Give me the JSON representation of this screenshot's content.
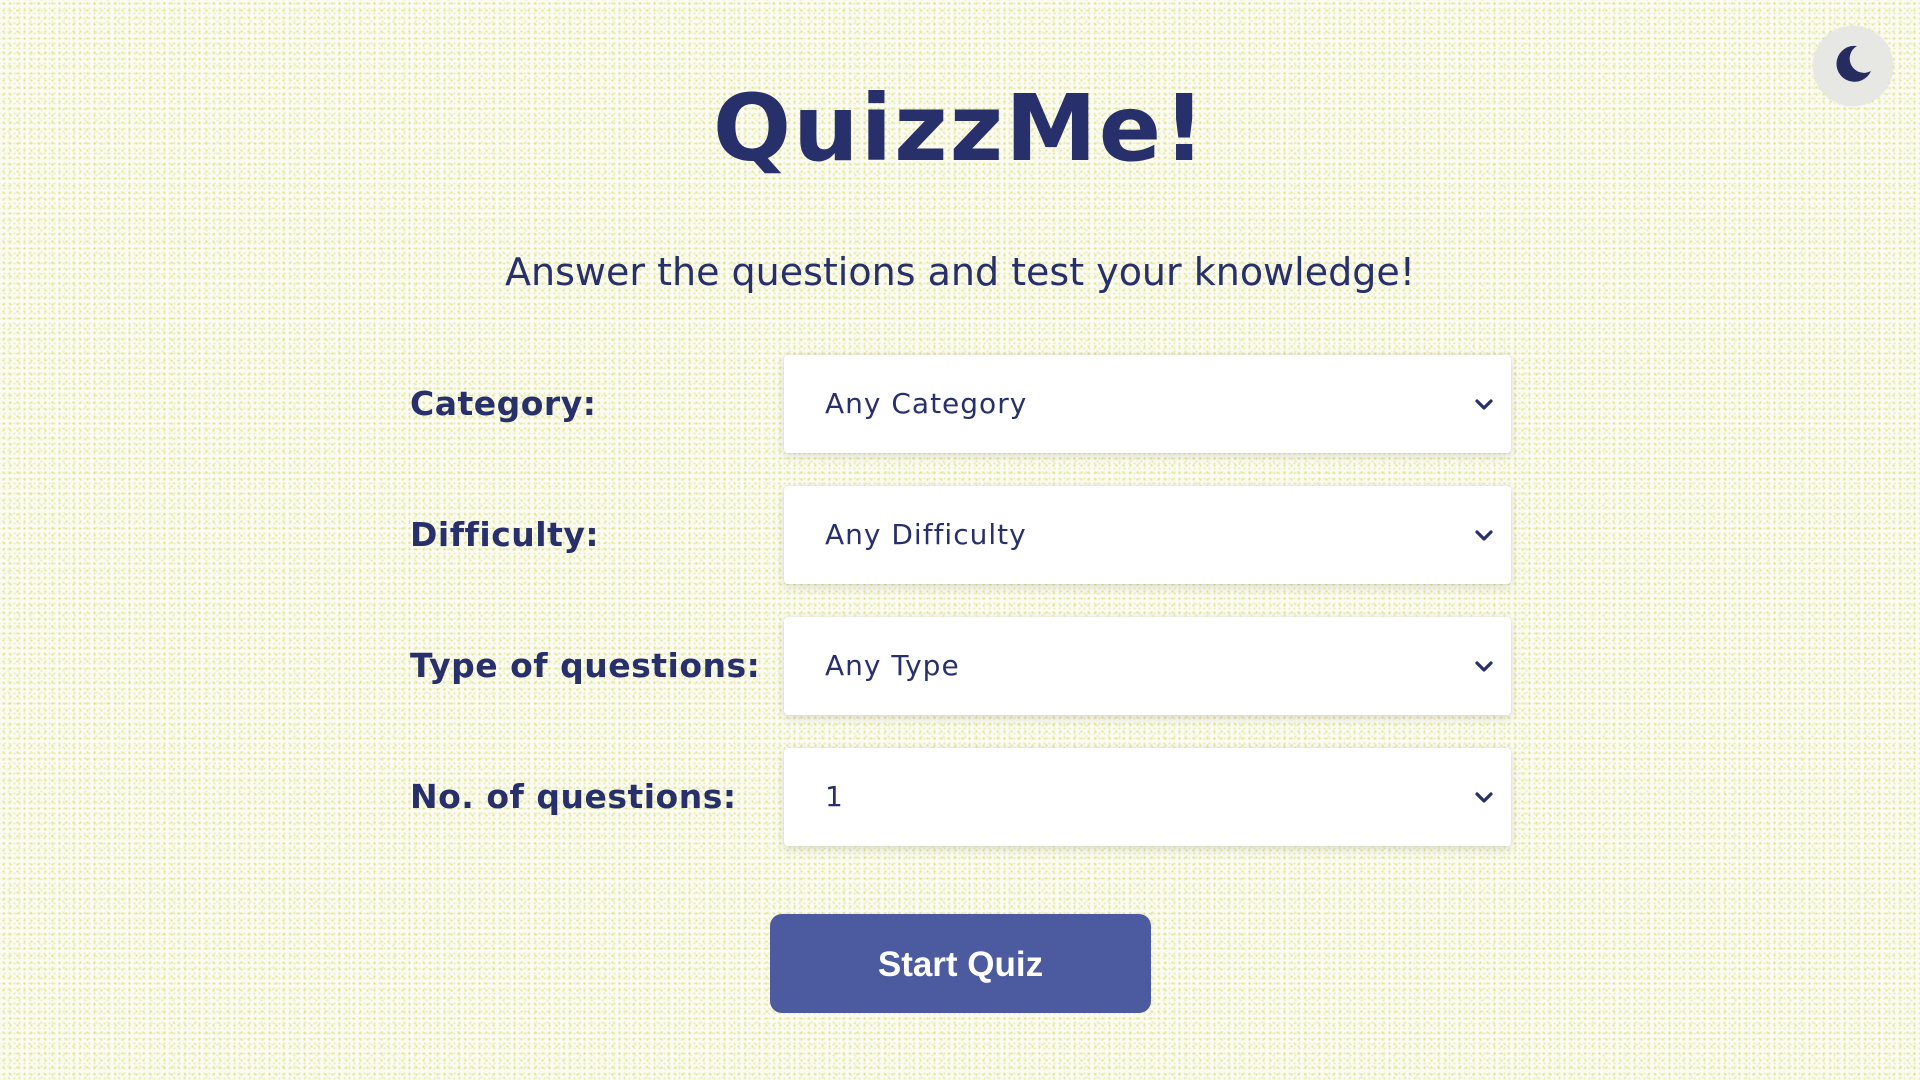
{
  "theme_toggle": {
    "icon": "moon-icon"
  },
  "header": {
    "title": "QuizzMe!",
    "subtitle": "Answer the questions and test your knowledge!"
  },
  "form": {
    "fields": [
      {
        "label": "Category:",
        "value": "Any Category"
      },
      {
        "label": "Difficulty:",
        "value": "Any Difficulty"
      },
      {
        "label": "Type of questions:",
        "value": "Any Type"
      },
      {
        "label": "No. of questions:",
        "value": "1"
      }
    ]
  },
  "actions": {
    "start_label": "Start Quiz"
  },
  "colors": {
    "primary_text": "#27306a",
    "button": "#4c5a9f",
    "background": "#fbfbf1"
  }
}
